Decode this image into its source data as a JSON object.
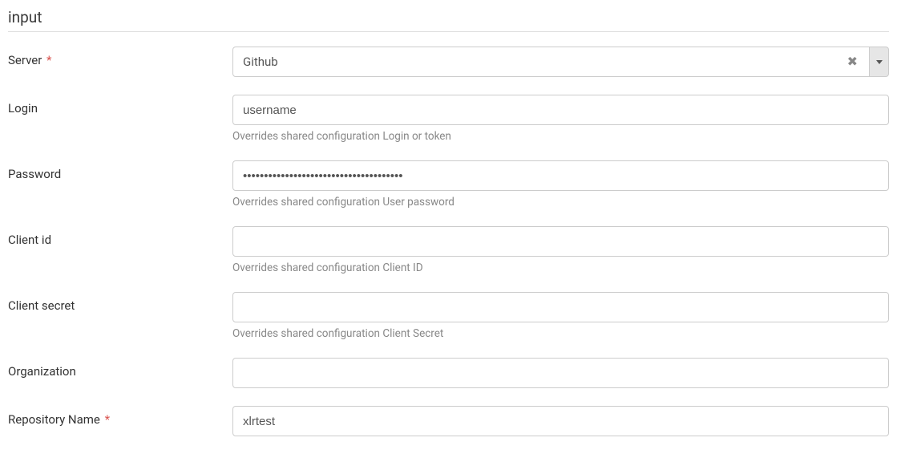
{
  "section": {
    "title": "input"
  },
  "fields": {
    "server": {
      "label": "Server",
      "required_marker": "*",
      "value": "Github"
    },
    "login": {
      "label": "Login",
      "value": "username",
      "help": "Overrides shared configuration Login or token"
    },
    "password": {
      "label": "Password",
      "value": "••••••••••••••••••••••••••••••••••••••",
      "help": "Overrides shared configuration User password"
    },
    "client_id": {
      "label": "Client id",
      "value": "",
      "help": "Overrides shared configuration Client ID"
    },
    "client_secret": {
      "label": "Client secret",
      "value": "",
      "help": "Overrides shared configuration Client Secret"
    },
    "organization": {
      "label": "Organization",
      "value": ""
    },
    "repository_name": {
      "label": "Repository Name",
      "required_marker": "*",
      "value": "xlrtest"
    }
  }
}
